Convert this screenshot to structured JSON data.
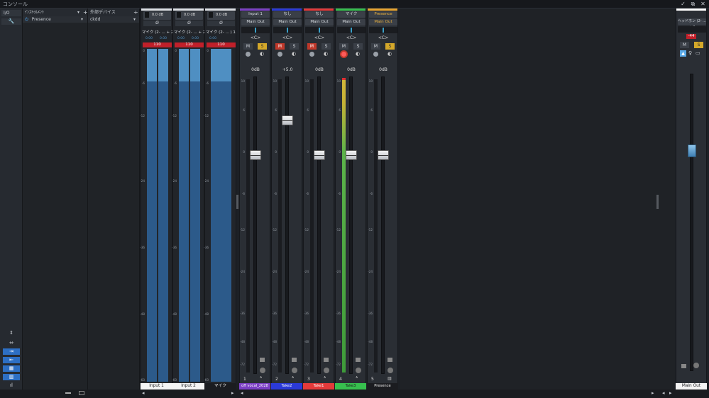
{
  "app": {
    "title": "コンソール"
  },
  "window_icons": [
    "check-icon",
    "detach-icon",
    "close-icon"
  ],
  "left_nav": {
    "io": "I/O",
    "wrench": "🔧"
  },
  "instruments": {
    "header": "ｲﾝｽﾄｩﾙﾒﾝﾄ",
    "items": [
      {
        "label": "Presence"
      }
    ]
  },
  "external": {
    "header": "外部デバイス",
    "items": [
      {
        "label": "ckdd"
      }
    ]
  },
  "inputs": [
    {
      "gain": "0.0 dB",
      "phase": "Ø",
      "route": "マイク (2- ... + 2",
      "val_l": "0.00",
      "val_r": "0.00",
      "badge": "110",
      "name": "Input 1"
    },
    {
      "gain": "0.0 dB",
      "phase": "Ø",
      "route": "マイク (2- ... + 2",
      "val_l": "0.00",
      "val_r": "0.00",
      "badge": "110",
      "name": "Input 2"
    },
    {
      "gain": "0.0 dB",
      "phase": "Ø",
      "route": "マイク (2- ... ) 1",
      "val_l": "0.00",
      "val_r": "",
      "badge": "110",
      "name": "マイク"
    }
  ],
  "channels": [
    {
      "input": "Input 1",
      "output": "Main Out",
      "pan": "<C>",
      "vol": "0dB",
      "num": "1",
      "auto": "ｵｰﾄ: ｵﾌ",
      "name": "off vocal_2028",
      "color": "#7b3fc4",
      "text_color": "#fff"
    },
    {
      "input": "なし",
      "output": "Main Out",
      "pan": "<C>",
      "vol": "+5.0",
      "num": "2",
      "auto": "ｵｰﾄ: ｵﾌ",
      "name": "Take2",
      "color": "#2b3ad8",
      "text_color": "#fff"
    },
    {
      "input": "なし",
      "output": "Main Out",
      "pan": "<C>",
      "vol": "0dB",
      "num": "3",
      "auto": "ｵｰﾄ: ｵﾌ",
      "name": "Take1",
      "color": "#e43a3a",
      "text_color": "#fff"
    },
    {
      "input": "マイク",
      "output": "Main Out",
      "pan": "<C>",
      "vol": "0dB",
      "num": "4",
      "auto": "ｵｰﾄ: ｵﾌ",
      "name": "Take3",
      "color": "#37c04e",
      "text_color": "#1a1a1a"
    },
    {
      "input": "Presence",
      "output": "Main Out",
      "pan": "<C>",
      "vol": "0dB",
      "num": "5",
      "auto": "ｵｰﾄ: ｵﾌ",
      "name": "Presence",
      "color": "#1b1c20",
      "text_color": "#f0f0f0"
    }
  ],
  "main": {
    "route": "ヘッドホン (2- ... + 2",
    "badge": "-44",
    "name": "Main Out"
  },
  "mute": "M",
  "solo": "S",
  "scale": [
    "10",
    "6",
    "0",
    "-6",
    "-12",
    "-24",
    "-36",
    "-48",
    "-72"
  ],
  "in_scale": [
    "0",
    "-6",
    "-12",
    "-24",
    "-36",
    "-48",
    "-60"
  ],
  "colors": {
    "accent": "#2d6fc4",
    "meter": "#2c5a8a",
    "meter_top": "#4f8fc2",
    "mute_on": "#c0392b",
    "solo_on": "#d4a82a",
    "clip": "#c0202a"
  }
}
